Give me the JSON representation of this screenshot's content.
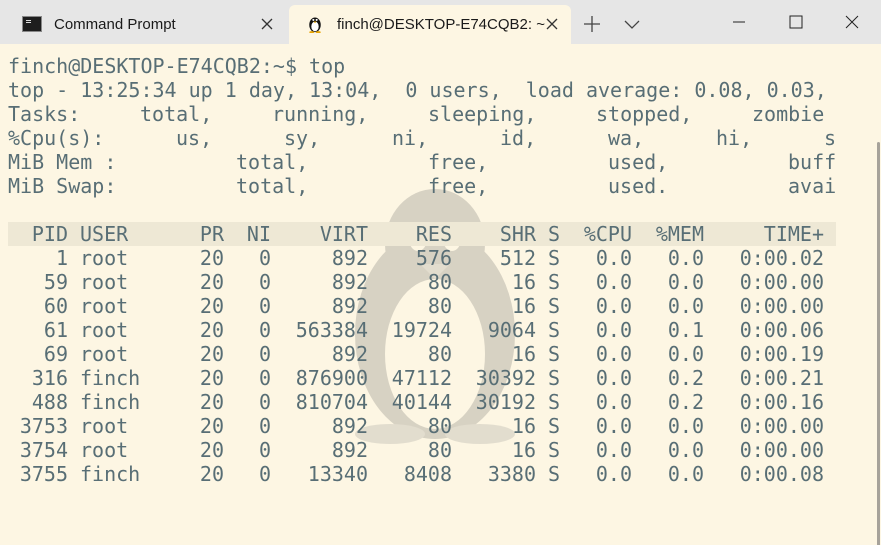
{
  "tabs": [
    {
      "label": "Command Prompt",
      "active": false,
      "icon": "cmd-icon"
    },
    {
      "label": "finch@DESKTOP-E74CQB2: ~",
      "active": true,
      "icon": "linux-penguin-icon"
    }
  ],
  "window_controls": {
    "minimize": "minimize-icon",
    "maximize": "maximize-icon",
    "close": "close-icon"
  },
  "colors": {
    "terminal_bg": "#fdf6e3",
    "text": "#586e75",
    "header_bg": "#eee8d5",
    "tabbar_bg": "#e6e6e6"
  },
  "terminal": {
    "prompt": "finch@DESKTOP-E74CQB2:~$ top",
    "summary": {
      "uptime_line": "top - 13:25:34 up 1 day, 13:04,  0 users,  load average: 0.08, 0.03,",
      "tasks": {
        "label": "Tasks:",
        "total": "total,",
        "running": "running,",
        "sleeping": "sleeping,",
        "stopped": "stopped,",
        "zombie": "zombie"
      },
      "cpu": {
        "label": "%Cpu(s):",
        "us": "us,",
        "sy": "sy,",
        "ni": "ni,",
        "id": "id,",
        "wa": "wa,",
        "hi": "hi,",
        "si": "s"
      },
      "mem": {
        "label": "MiB Mem :",
        "total": "total,",
        "free": "free,",
        "used": "used,",
        "buff": "buff"
      },
      "swap": {
        "label": "MiB Swap:",
        "total": "total,",
        "free": "free,",
        "used": "used.",
        "avail": "avai"
      }
    },
    "columns": [
      "PID",
      "USER",
      "PR",
      "NI",
      "VIRT",
      "RES",
      "SHR",
      "S",
      "%CPU",
      "%MEM",
      "TIME+"
    ],
    "processes": [
      [
        "1",
        "root",
        "20",
        "0",
        "892",
        "576",
        "512",
        "S",
        "0.0",
        "0.0",
        "0:00.02"
      ],
      [
        "59",
        "root",
        "20",
        "0",
        "892",
        "80",
        "16",
        "S",
        "0.0",
        "0.0",
        "0:00.00"
      ],
      [
        "60",
        "root",
        "20",
        "0",
        "892",
        "80",
        "16",
        "S",
        "0.0",
        "0.0",
        "0:00.00"
      ],
      [
        "61",
        "root",
        "20",
        "0",
        "563384",
        "19724",
        "9064",
        "S",
        "0.0",
        "0.1",
        "0:00.06"
      ],
      [
        "69",
        "root",
        "20",
        "0",
        "892",
        "80",
        "16",
        "S",
        "0.0",
        "0.0",
        "0:00.19"
      ],
      [
        "316",
        "finch",
        "20",
        "0",
        "876900",
        "47112",
        "30392",
        "S",
        "0.0",
        "0.2",
        "0:00.21"
      ],
      [
        "488",
        "finch",
        "20",
        "0",
        "810704",
        "40144",
        "30192",
        "S",
        "0.0",
        "0.2",
        "0:00.16"
      ],
      [
        "3753",
        "root",
        "20",
        "0",
        "892",
        "80",
        "16",
        "S",
        "0.0",
        "0.0",
        "0:00.00"
      ],
      [
        "3754",
        "root",
        "20",
        "0",
        "892",
        "80",
        "16",
        "S",
        "0.0",
        "0.0",
        "0:00.00"
      ],
      [
        "3755",
        "finch",
        "20",
        "0",
        "13340",
        "8408",
        "3380",
        "S",
        "0.0",
        "0.0",
        "0:00.08"
      ]
    ]
  }
}
